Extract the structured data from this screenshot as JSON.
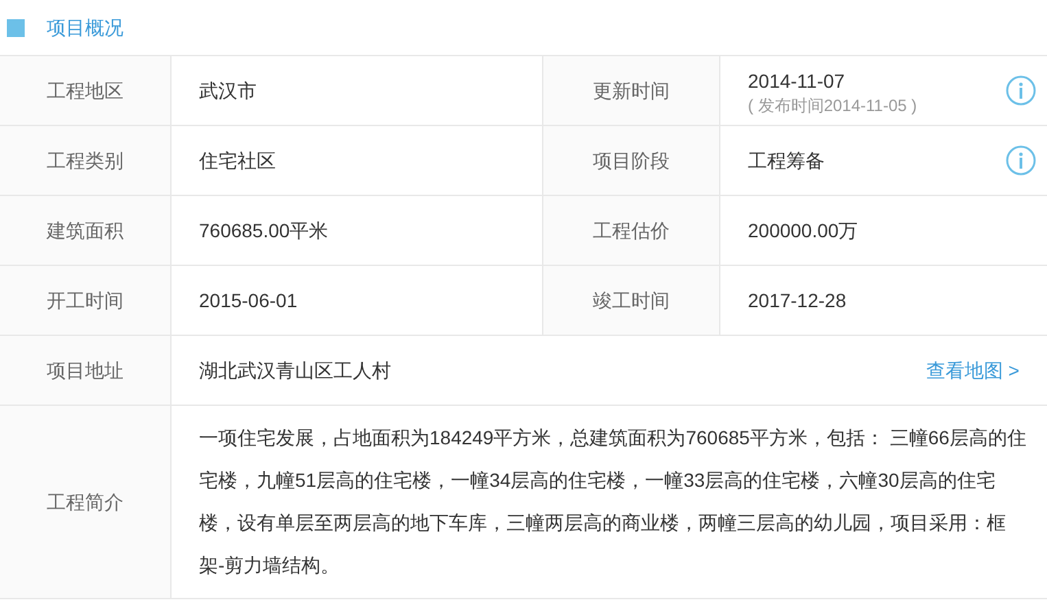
{
  "section": {
    "title": "项目概况"
  },
  "rows": [
    {
      "kind": "pair",
      "cells": [
        {
          "label": "工程地区",
          "value": "武汉市",
          "info": false
        },
        {
          "label": "更新时间",
          "value": "2014-11-07",
          "note": "( 发布时间2014-11-05 )",
          "info": true
        }
      ]
    },
    {
      "kind": "pair",
      "cells": [
        {
          "label": "工程类别",
          "value": "住宅社区",
          "info": false
        },
        {
          "label": "项目阶段",
          "value": "工程筹备",
          "info": true
        }
      ]
    },
    {
      "kind": "pair",
      "cells": [
        {
          "label": "建筑面积",
          "value": "760685.00平米",
          "info": false
        },
        {
          "label": "工程估价",
          "value": "200000.00万",
          "info": false
        }
      ]
    },
    {
      "kind": "pair",
      "cells": [
        {
          "label": "开工时间",
          "value": "2015-06-01",
          "info": false
        },
        {
          "label": "竣工时间",
          "value": "2017-12-28",
          "info": false
        }
      ]
    },
    {
      "kind": "address",
      "label": "项目地址",
      "value": "湖北武汉青山区工人村",
      "link": "查看地图 >"
    },
    {
      "kind": "description",
      "label": "工程简介",
      "value": "一项住宅发展，占地面积为184249平方米，总建筑面积为760685平方米，包括： 三幢66层高的住宅楼，九幢51层高的住宅楼，一幢34层高的住宅楼，一幢33层高的住宅楼，六幢30层高的住宅楼，设有单层至两层高的地下车库，三幢两层高的商业楼，两幢三层高的幼儿园，项目采用：框架-剪力墙结构。"
    }
  ]
}
